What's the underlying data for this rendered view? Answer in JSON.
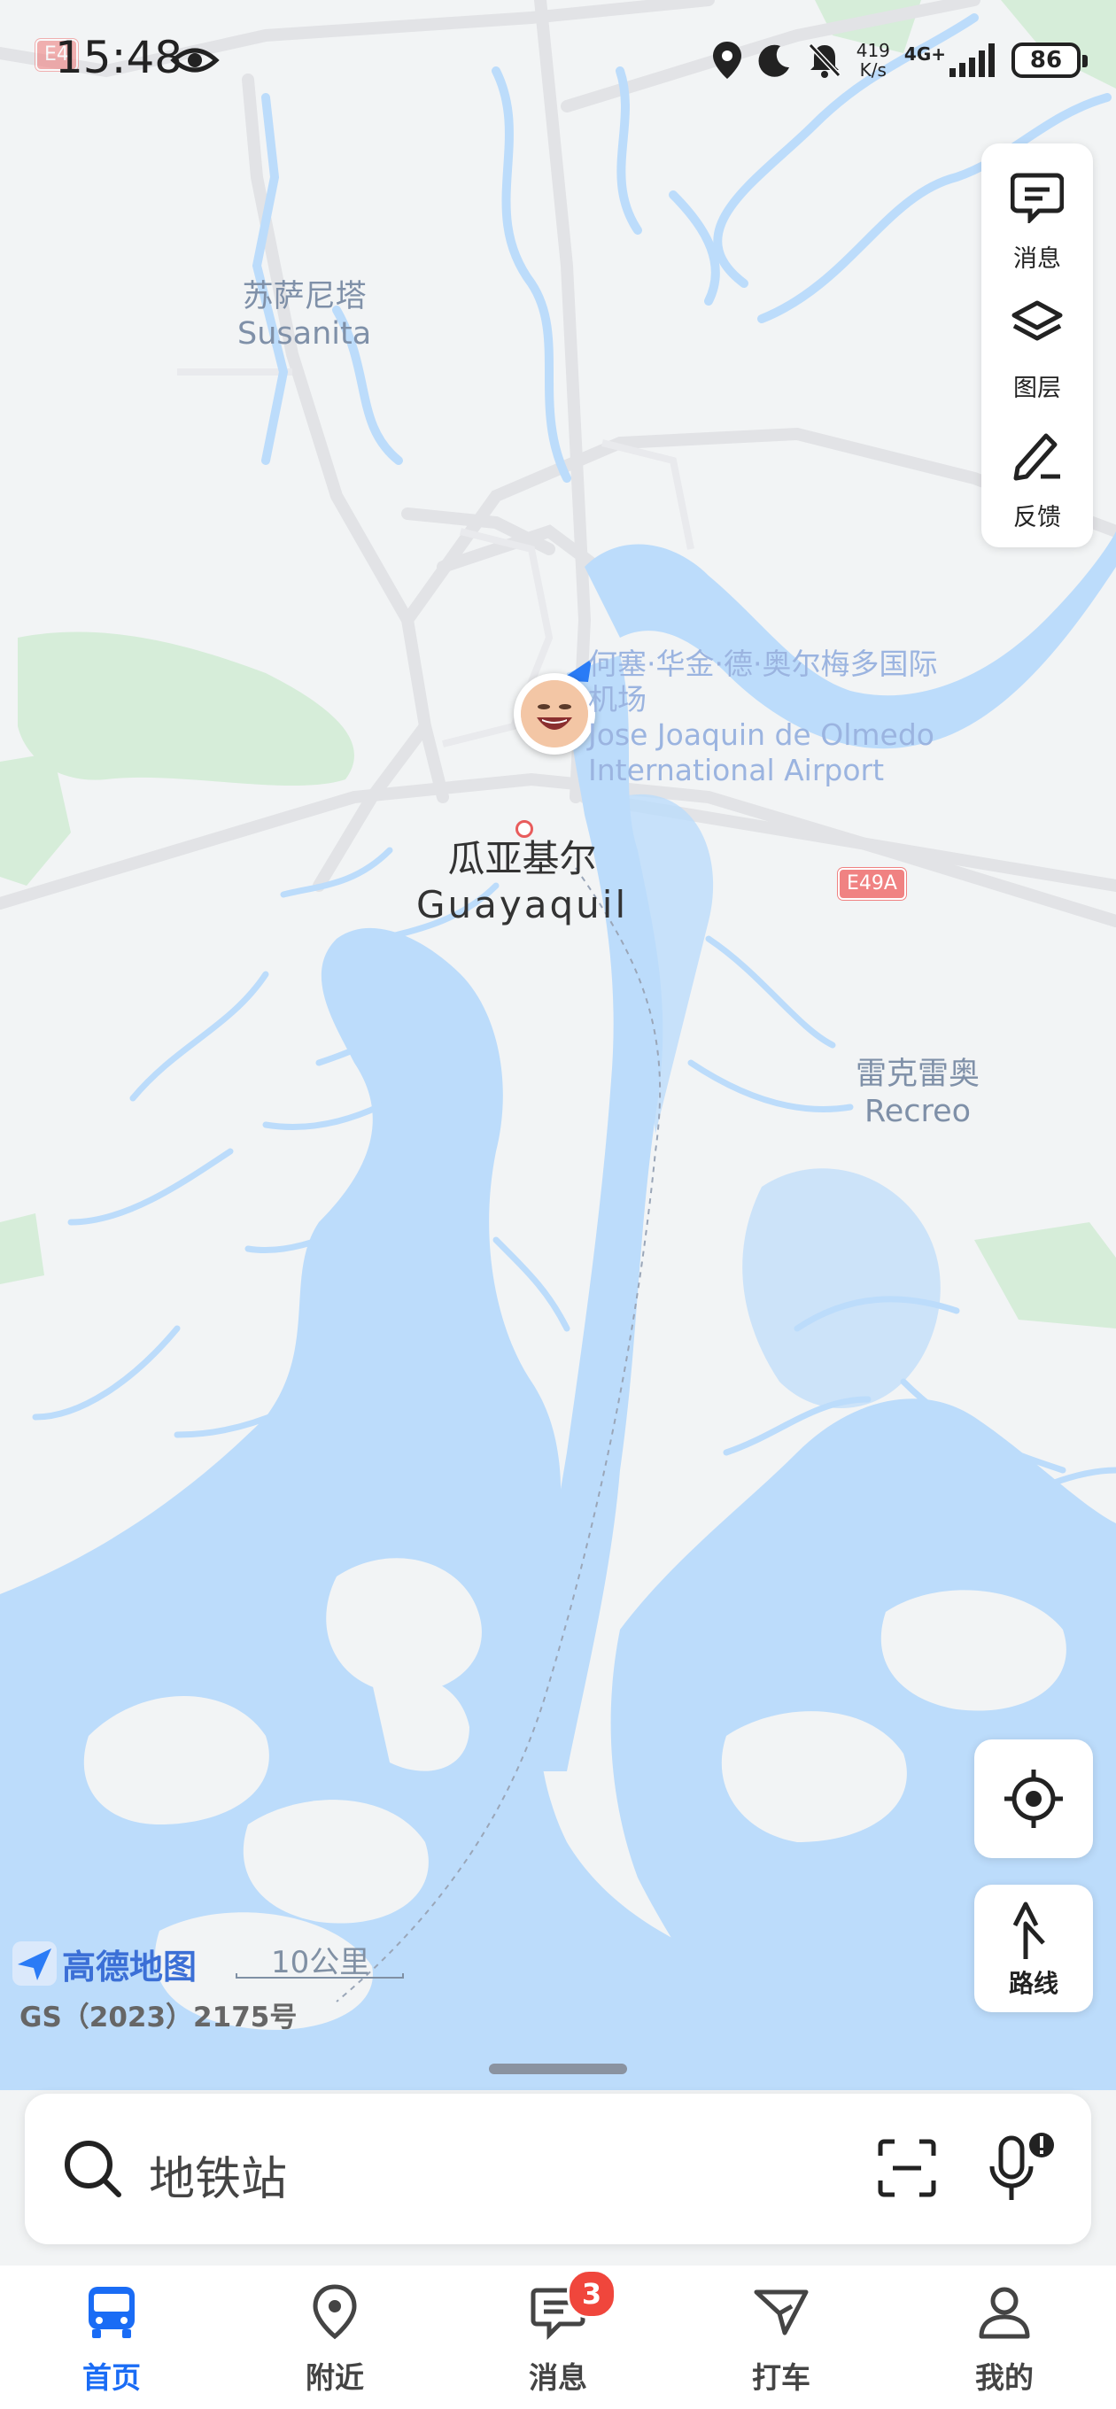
{
  "status": {
    "time": "15:48",
    "net_speed_value": "419",
    "net_speed_unit": "K/s",
    "signal": "4G+",
    "battery": "86"
  },
  "tools": {
    "messages": "消息",
    "layers": "图层",
    "feedback": "反馈"
  },
  "map": {
    "labels": {
      "susanita_cn": "苏萨尼塔",
      "susanita_en": "Susanita",
      "airport_cn_line1": "何塞·华金·德·奥尔梅多国际",
      "airport_cn_line2": "机场",
      "airport_en_line1": "Jose Joaquin de Olmedo",
      "airport_en_line2": "International Airport",
      "guayaquil_cn": "瓜亚基尔",
      "guayaquil_en": "Guayaquil",
      "recreo_cn": "雷克雷奥",
      "recreo_en": "Recreo",
      "road_e49a": "E49A",
      "road_e4": "E4"
    },
    "logo": "高德地图",
    "scale": "10公里",
    "gs_number": "GS（2023）2175号"
  },
  "controls": {
    "route": "路线"
  },
  "search": {
    "text": "地铁站"
  },
  "nav": {
    "home": "首页",
    "nearby": "附近",
    "messages": "消息",
    "messages_badge": "3",
    "taxi": "打车",
    "mine": "我的"
  },
  "colors": {
    "water": "#bcdcfb",
    "land": "#f2f4f5",
    "park": "#d6edd9",
    "road": "#e2e3e6",
    "accent": "#1a6cf5",
    "badge": "#f0463c"
  }
}
